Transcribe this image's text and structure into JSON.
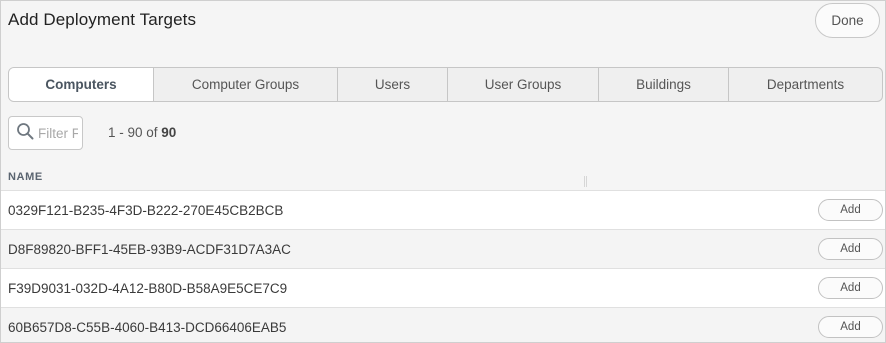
{
  "dialog": {
    "title": "Add Deployment Targets",
    "done_label": "Done"
  },
  "tabs": [
    {
      "label": "Computers",
      "active": true
    },
    {
      "label": "Computer Groups",
      "active": false
    },
    {
      "label": "Users",
      "active": false
    },
    {
      "label": "User Groups",
      "active": false
    },
    {
      "label": "Buildings",
      "active": false
    },
    {
      "label": "Departments",
      "active": false
    }
  ],
  "filter": {
    "placeholder": "Filter F",
    "value": "",
    "icon": "search-icon"
  },
  "pager": {
    "range": "1 - 90 of ",
    "total": "90"
  },
  "table": {
    "column_header": "NAME",
    "rows": [
      {
        "name": "0329F121-B235-4F3D-B222-270E45CB2BCB",
        "action": "Add"
      },
      {
        "name": "D8F89820-BFF1-45EB-93B9-ACDF31D7A3AC",
        "action": "Add"
      },
      {
        "name": "F39D9031-032D-4A12-B80D-B58A9E5CE7C9",
        "action": "Add"
      },
      {
        "name": "60B657D8-C55B-4060-B413-DCD66406EAB5",
        "action": "Add"
      }
    ]
  },
  "colors": {
    "active_tab_text": "#4a5560",
    "background": "#f5f5f5"
  }
}
